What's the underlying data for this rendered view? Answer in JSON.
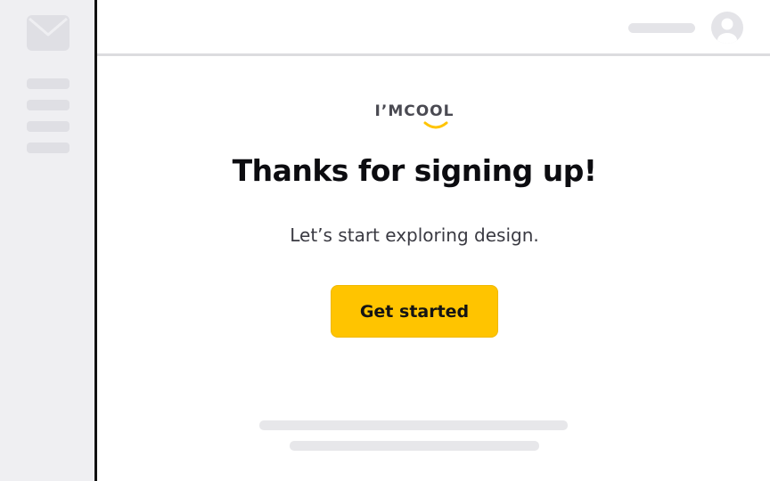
{
  "sidebar": {
    "icon": "mail-icon",
    "menu_items": 4
  },
  "header": {
    "avatar_icon": "user-avatar-icon"
  },
  "email": {
    "logo_text": "I’MCOOL",
    "headline": "Thanks for signing up!",
    "subline": "Let’s start exploring design.",
    "cta_label": "Get started"
  },
  "colors": {
    "accent": "#ffc400",
    "sidebar_bg": "#efeff2",
    "divider": "#111111",
    "placeholder": "#e4e4e8"
  }
}
